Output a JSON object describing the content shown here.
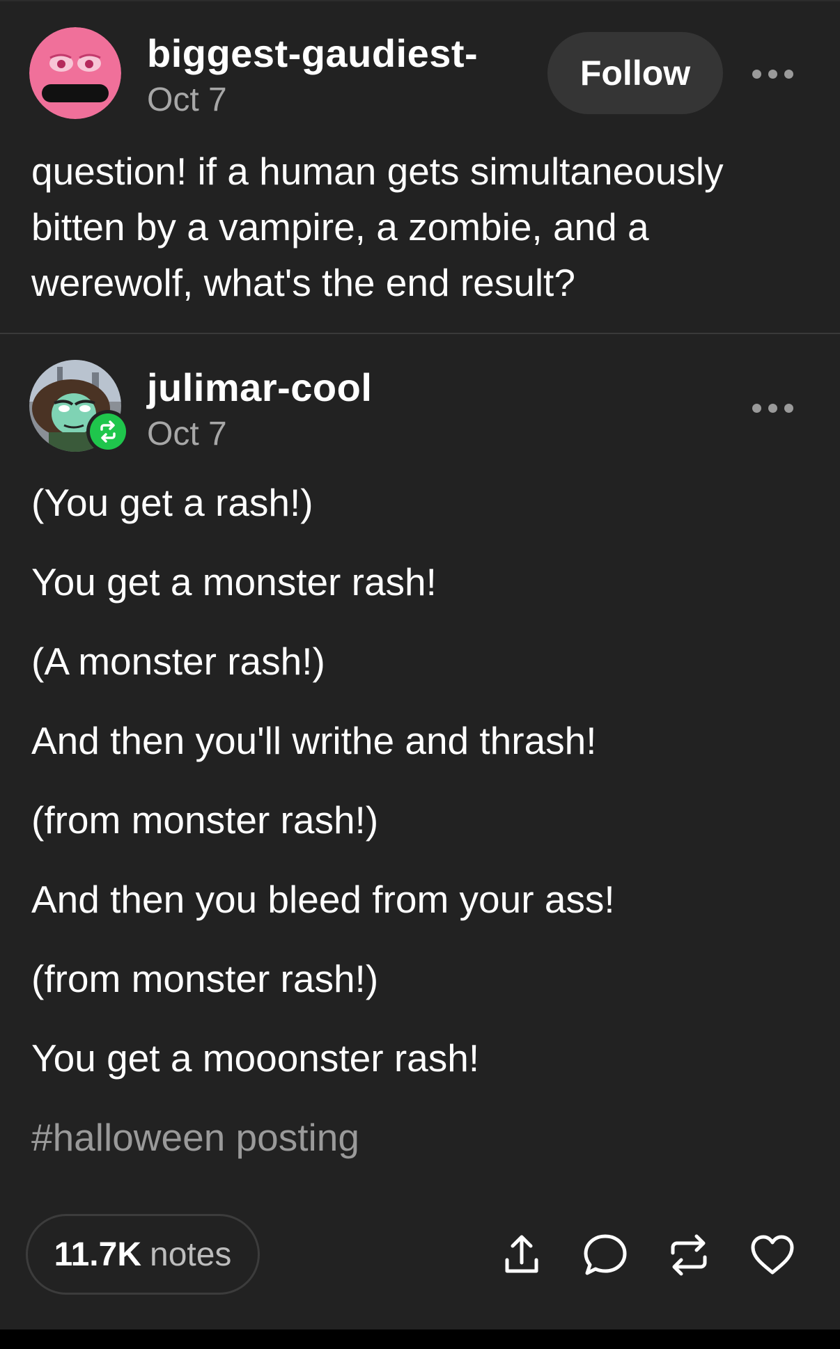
{
  "original_post": {
    "username": "biggest-gaudiest-",
    "date": "Oct 7",
    "follow_label": "Follow",
    "avatar_icon": "pink-face-avatar",
    "avatar_color": "#f0709a",
    "text": "question! if a human gets simultaneously bitten by a vampire, a zombie, and a werewolf, what's the end result?"
  },
  "reblog": {
    "username": "julimar-cool",
    "date": "Oct 7",
    "avatar_icon": "green-face-avatar",
    "badge_icon": "reblog-icon",
    "badge_color": "#1fc64c",
    "lines": [
      "(You get a rash!)",
      "You get a monster rash!",
      "(A monster rash!)",
      "And then you'll writhe and thrash!",
      "(from monster rash!)",
      "And then you bleed from your ass!",
      "(from monster rash!)",
      "You get a mooonster rash!"
    ],
    "tag": "#halloween posting"
  },
  "footer": {
    "notes_count": "11.7K",
    "notes_label": "notes",
    "actions": [
      "share-icon",
      "comment-icon",
      "reblog-icon",
      "heart-icon"
    ]
  },
  "colors": {
    "background": "#222222",
    "text": "#ffffff",
    "muted": "#a7a7a7",
    "follow_button": "#353535"
  }
}
